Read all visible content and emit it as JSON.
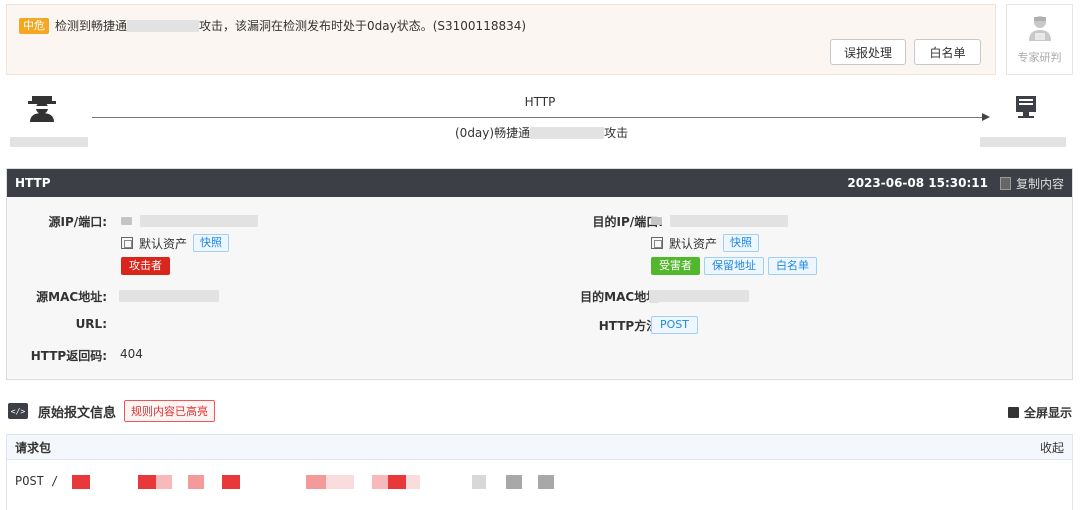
{
  "alert": {
    "severity": "中危",
    "text_prefix": "检测到畅捷通",
    "text_suffix": "攻击，该漏洞在检测发布时处于0day状态。(S3100118834)",
    "false_positive_button": "误报处理",
    "whitelist_button": "白名单",
    "expert_label": "专家研判"
  },
  "flow": {
    "protocol": "HTTP",
    "attack_prefix": "(0day)畅捷通",
    "attack_suffix": "攻击"
  },
  "detail": {
    "title": "HTTP",
    "timestamp": "2023-06-08 15:30:11",
    "copy_label": "复制内容",
    "src_ip_label": "源IP/端口:",
    "dst_ip_label": "目的IP/端口:",
    "src_asset": "默认资产",
    "dst_asset": "默认资产",
    "snapshot_label": "快照",
    "attacker_tag": "攻击者",
    "victim_tag": "受害者",
    "reserved_tag": "保留地址",
    "whitelist_tag": "白名单",
    "src_mac_label": "源MAC地址:",
    "dst_mac_label": "目的MAC地址:",
    "url_label": "URL:",
    "http_method_label": "HTTP方法:",
    "http_method": "POST",
    "http_code_label": "HTTP返回码:",
    "http_code": "404"
  },
  "raw": {
    "title": "原始报文信息",
    "highlight_badge": "规则内容已高亮",
    "fullscreen_label": "全屏显示",
    "request_label": "请求包",
    "collapse_label": "收起",
    "first_line": "POST /"
  },
  "colors": {
    "severity": "#f5a623",
    "attacker": "#d9261c",
    "victim": "#52b72c",
    "header_bg": "#3c3f45",
    "link": "#1e88e5"
  }
}
